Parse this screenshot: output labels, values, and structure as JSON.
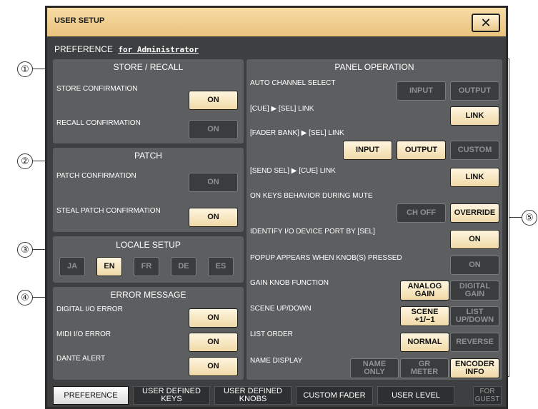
{
  "window": {
    "title": "USER SETUP",
    "close_label": "✕"
  },
  "preference": {
    "heading": "PREFERENCE",
    "target": "for Administrator"
  },
  "callouts": [
    "①",
    "②",
    "③",
    "④",
    "⑤"
  ],
  "store_recall": {
    "title": "STORE / RECALL",
    "store_label": "STORE CONFIRMATION",
    "store_state": "ON",
    "recall_label": "RECALL CONFIRMATION",
    "recall_state": "ON"
  },
  "patch": {
    "title": "PATCH",
    "patch_label": "PATCH CONFIRMATION",
    "patch_state": "ON",
    "steal_label": "STEAL PATCH CONFIRMATION",
    "steal_state": "ON"
  },
  "locale": {
    "title": "LOCALE SETUP",
    "options": [
      "JA",
      "EN",
      "FR",
      "DE",
      "ES"
    ],
    "selected": "EN"
  },
  "error": {
    "title": "ERROR MESSAGE",
    "digital_label": "DIGITAL I/O ERROR",
    "digital_state": "ON",
    "midi_label": "MIDI I/O ERROR",
    "midi_state": "ON",
    "dante_label": "DANTE ALERT",
    "dante_state": "ON"
  },
  "panel_op": {
    "title": "PANEL OPERATION",
    "auto_channel": {
      "label": "AUTO CHANNEL SELECT",
      "input": "INPUT",
      "output": "OUTPUT"
    },
    "cue_sel": {
      "label": "[CUE] ▶ [SEL] LINK",
      "button": "LINK"
    },
    "fader_bank": {
      "label": "[FADER BANK] ▶ [SEL] LINK",
      "input": "INPUT",
      "output": "OUTPUT",
      "custom": "CUSTOM"
    },
    "send_sel": {
      "label": "[SEND SEL] ▶ [CUE] LINK",
      "button": "LINK"
    },
    "on_keys": {
      "label": "ON KEYS BEHAVIOR DURING MUTE",
      "ch_off": "CH OFF",
      "override": "OVERRIDE"
    },
    "identify": {
      "label": "IDENTIFY I/O DEVICE PORT BY [SEL]",
      "state": "ON"
    },
    "popup": {
      "label": "POPUP APPEARS WHEN KNOB(S) PRESSED",
      "state": "ON"
    },
    "gain_knob": {
      "label": "GAIN KNOB FUNCTION",
      "analog_1": "ANALOG",
      "analog_2": "GAIN",
      "digital_1": "DIGITAL",
      "digital_2": "GAIN"
    },
    "scene": {
      "label": "SCENE UP/DOWN",
      "scene_1": "SCENE",
      "scene_2": "+1/−1",
      "list_1": "LIST",
      "list_2": "UP/DOWN"
    },
    "list_order": {
      "label": "LIST ORDER",
      "normal": "NORMAL",
      "reverse": "REVERSE"
    },
    "name_display": {
      "label": "NAME DISPLAY",
      "name_1": "NAME",
      "name_2": "ONLY",
      "gr_1": "GR",
      "gr_2": "METER",
      "enc_1": "ENCODER",
      "enc_2": "INFO"
    }
  },
  "tabs": {
    "preference": "PREFERENCE",
    "ud_keys_1": "USER DEFINED",
    "ud_keys_2": "KEYS",
    "ud_knobs_1": "USER DEFINED",
    "ud_knobs_2": "KNOBS",
    "custom_fader": "CUSTOM FADER",
    "user_level": "USER LEVEL",
    "guest_1": "FOR",
    "guest_2": "GUEST"
  },
  "colors": {
    "panel": "#5c5e60",
    "window": "#3d3f40",
    "titlebar": "#f0cf90",
    "button_on": "#f0d9a7"
  }
}
